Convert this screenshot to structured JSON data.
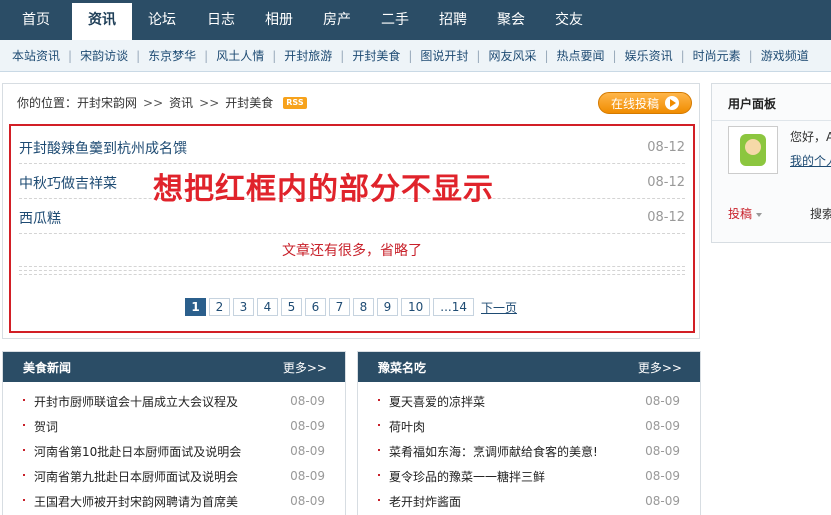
{
  "topnav": [
    {
      "label": "首页",
      "active": false
    },
    {
      "label": "资讯",
      "active": true
    },
    {
      "label": "论坛",
      "active": false
    },
    {
      "label": "日志",
      "active": false
    },
    {
      "label": "相册",
      "active": false
    },
    {
      "label": "房产",
      "active": false
    },
    {
      "label": "二手",
      "active": false
    },
    {
      "label": "招聘",
      "active": false
    },
    {
      "label": "聚会",
      "active": false
    },
    {
      "label": "交友",
      "active": false
    }
  ],
  "subnav": [
    "本站资讯",
    "宋韵访谈",
    "东京梦华",
    "风土人情",
    "开封旅游",
    "开封美食",
    "图说开封",
    "网友风采",
    "热点要闻",
    "娱乐资讯",
    "时尚元素",
    "游戏频道"
  ],
  "breadcrumb": {
    "prefix": "你的位置：开封宋韵网",
    "sep": ">>",
    "items": [
      "资讯",
      "开封美食"
    ],
    "rss": "RSS"
  },
  "submit_button": "在线投稿",
  "articles": [
    {
      "title": "开封酸辣鱼羹到杭州成名馔",
      "date": "08-12"
    },
    {
      "title": "中秋巧做吉祥菜",
      "date": "08-12"
    },
    {
      "title": "西瓜糕",
      "date": "08-12"
    }
  ],
  "overlay_note": "想把红框内的部分不显示",
  "omit_note": "文章还有很多，省略了",
  "pagination": {
    "pages": [
      "1",
      "2",
      "3",
      "4",
      "5",
      "6",
      "7",
      "8",
      "9",
      "10",
      "...14"
    ],
    "current": "1",
    "next": "下一页"
  },
  "user_panel": {
    "title": "用户面板",
    "greeting": "您好，A",
    "profile_link": "我的个人",
    "submit": "投稿",
    "search": "搜索"
  },
  "boxes": [
    {
      "title": "美食新闻",
      "more": "更多>>",
      "items": [
        {
          "title": "开封市厨师联谊会十届成立大会议程及",
          "date": "08-09"
        },
        {
          "title": "贺词",
          "date": "08-09"
        },
        {
          "title": "河南省第10批赴日本厨师面试及说明会",
          "date": "08-09"
        },
        {
          "title": "河南省第九批赴日本厨师面试及说明会",
          "date": "08-09"
        },
        {
          "title": "王国君大师被开封宋韵网聘请为首席美",
          "date": "08-09"
        }
      ]
    },
    {
      "title": "豫菜名吃",
      "more": "更多>>",
      "items": [
        {
          "title": "夏天喜爱的凉拌菜",
          "date": "08-09"
        },
        {
          "title": "荷叶肉",
          "date": "08-09"
        },
        {
          "title": "菜肴福如东海：烹调师献给食客的美意!",
          "date": "08-09"
        },
        {
          "title": "夏令珍品的豫菜一一糖拌三鲜",
          "date": "08-09"
        },
        {
          "title": "老开封炸酱面",
          "date": "08-09"
        }
      ]
    }
  ]
}
